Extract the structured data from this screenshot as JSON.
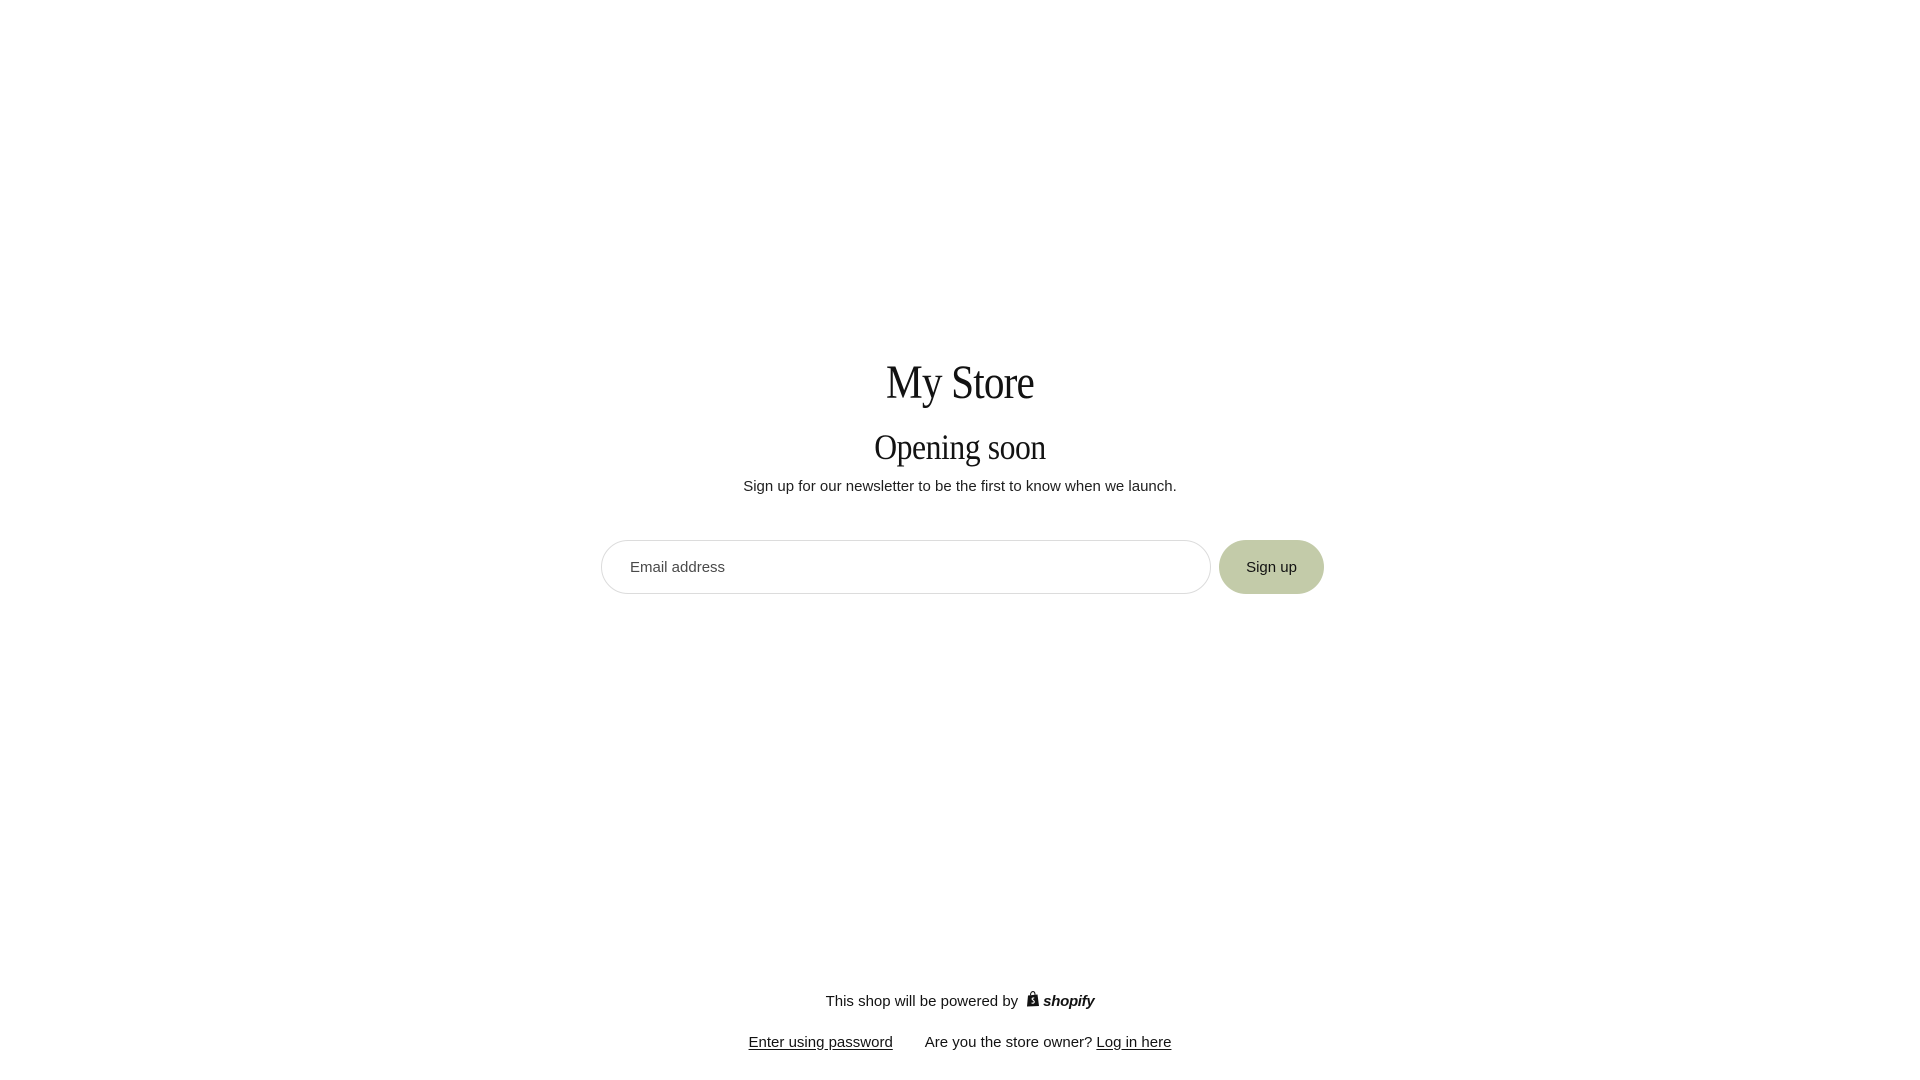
{
  "store": {
    "name": "My Store",
    "headline": "Opening soon",
    "subtext": "Sign up for our newsletter to be the first to know when we launch."
  },
  "signup": {
    "email_placeholder": "Email address",
    "button_label": "Sign up",
    "button_color": "#c3cba9"
  },
  "footer": {
    "powered_by_text": "This shop will be powered by",
    "shopify_logo_text": "shopify",
    "enter_password_label": "Enter using password",
    "owner_question": "Are you the store owner?",
    "login_label": "Log in here"
  },
  "icons": {
    "shopify_logo": "shopify-bag-icon"
  }
}
